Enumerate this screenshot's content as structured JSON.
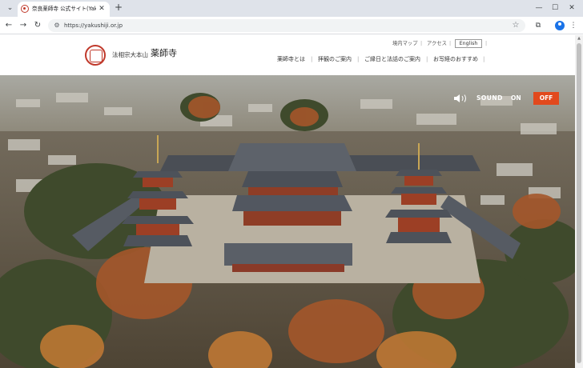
{
  "browser": {
    "tab_title": "奈良薬師寺 公式サイト(Yakushiji...",
    "url": "https://yakushiji.or.jp",
    "icons": {
      "tab_dropdown": "chevron-down-icon",
      "close": "close-icon",
      "new_tab": "plus-icon",
      "back": "back-arrow-icon",
      "forward": "forward-arrow-icon",
      "reload": "reload-icon",
      "site_info": "tune-icon",
      "bookmark": "star-icon",
      "extensions": "puzzle-icon",
      "profile": "profile-icon",
      "menu": "kebab-menu-icon"
    },
    "window_controls": {
      "minimize": "—",
      "maximize": "☐",
      "close": "✕"
    }
  },
  "site": {
    "sect_name": "法相宗大本山",
    "temple_name": "薬師寺",
    "utility_nav": {
      "map": "境内マップ",
      "access": "アクセス",
      "language": "English"
    },
    "main_nav": [
      {
        "label": "薬師寺とは"
      },
      {
        "label": "拝観のご案内"
      },
      {
        "label": "ご縁日と法話のご案内"
      },
      {
        "label": "お写経のおすすめ"
      }
    ],
    "brand_color": "#c0392b"
  },
  "hero": {
    "sound_label": "SOUND",
    "on_label": "ON",
    "off_label": "OFF",
    "off_color": "#e2491d"
  }
}
